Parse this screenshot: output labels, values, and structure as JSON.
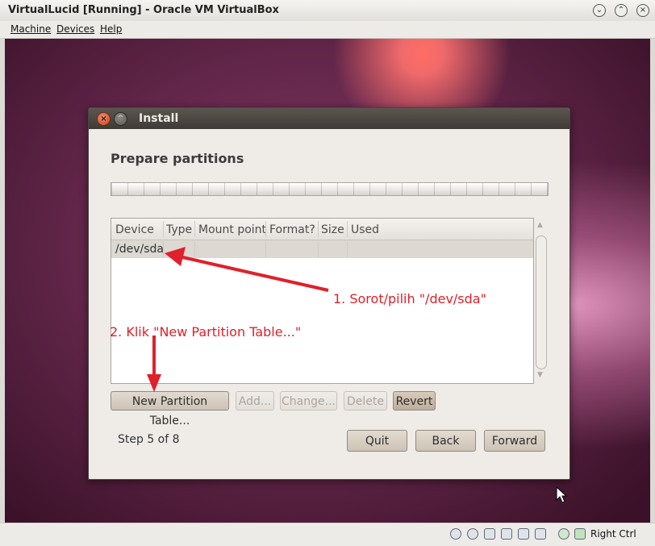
{
  "window": {
    "title": "VirtualLucid [Running] - Oracle VM VirtualBox"
  },
  "menubar": {
    "items": [
      "Machine",
      "Devices",
      "Help"
    ]
  },
  "dialog": {
    "title": "Install",
    "heading": "Prepare partitions",
    "table": {
      "columns": [
        "Device",
        "Type",
        "Mount point",
        "Format?",
        "Size",
        "Used"
      ],
      "rows": [
        {
          "device": "/dev/sda"
        }
      ]
    },
    "buttons": {
      "new_partition_table": "New Partition Table...",
      "add": "Add...",
      "change": "Change...",
      "delete": "Delete",
      "revert": "Revert"
    },
    "step_text": "Step 5 of 8",
    "nav": {
      "quit": "Quit",
      "back": "Back",
      "forward": "Forward"
    }
  },
  "annotations": {
    "note1": "1. Sorot/pilih \"/dev/sda\"",
    "note2": "2. Klik \"New Partition Table...\"",
    "color": "#e0202a"
  },
  "statusbar": {
    "host_key": "Right Ctrl"
  }
}
